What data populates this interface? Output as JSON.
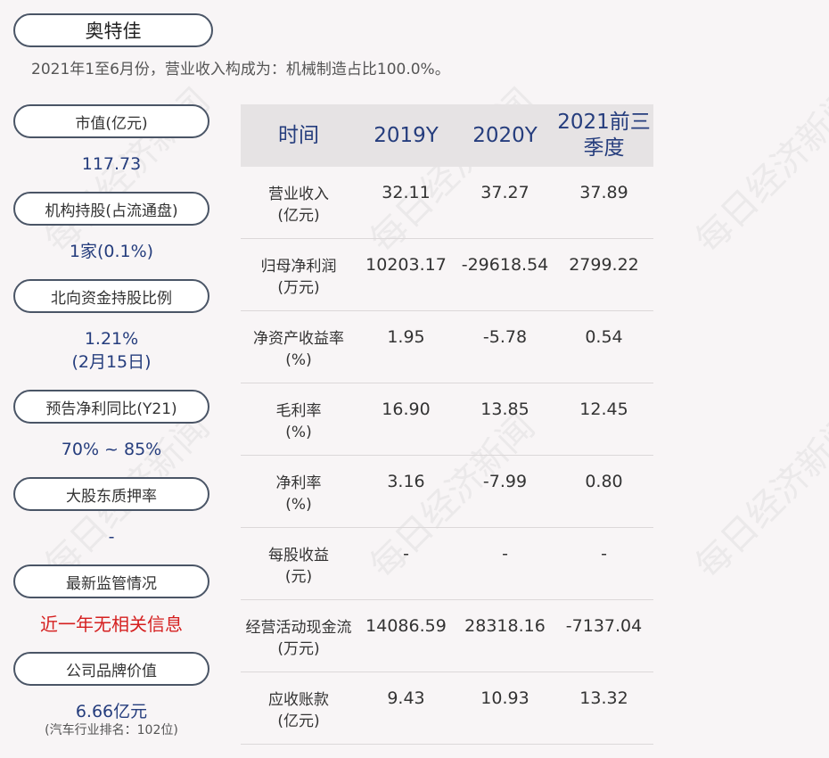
{
  "company": "奥特佳",
  "summary": "2021年1至6月份，营业收入构成为：机械制造占比100.0%。",
  "left_cards": [
    {
      "label": "市值(亿元)",
      "value": "117.73"
    },
    {
      "label": "机构持股(占流通盘)",
      "value": "1家(0.1%)"
    },
    {
      "label": "北向资金持股比例",
      "value": "1.21%",
      "value2": "(2月15日)"
    },
    {
      "label": "预告净利同比(Y21)",
      "value": "70% ~ 85%"
    },
    {
      "label": "大股东质押率",
      "value": "-"
    },
    {
      "label": "最新监管情况",
      "value": "近一年无相关信息"
    },
    {
      "label": "公司品牌价值",
      "value": "6.66亿元",
      "sub": "(汽车行业排名：102位)"
    }
  ],
  "table": {
    "headers": [
      "时间",
      "2019Y",
      "2020Y",
      "2021前三季度"
    ],
    "rows": [
      {
        "label1": "营业收入",
        "label2": "(亿元)",
        "v": [
          "32.11",
          "37.27",
          "37.89"
        ]
      },
      {
        "label1": "归母净利润",
        "label2": "(万元)",
        "v": [
          "10203.17",
          "-29618.54",
          "2799.22"
        ]
      },
      {
        "label1": "净资产收益率",
        "label2": "(%)",
        "v": [
          "1.95",
          "-5.78",
          "0.54"
        ]
      },
      {
        "label1": "毛利率",
        "label2": "(%)",
        "v": [
          "16.90",
          "13.85",
          "12.45"
        ]
      },
      {
        "label1": "净利率",
        "label2": "(%)",
        "v": [
          "3.16",
          "-7.99",
          "0.80"
        ]
      },
      {
        "label1": "每股收益",
        "label2": "(元)",
        "v": [
          "-",
          "-",
          "-"
        ]
      },
      {
        "label1": "经营活动现金流",
        "label2": "(万元)",
        "v": [
          "14086.59",
          "28318.16",
          "-7137.04"
        ]
      },
      {
        "label1": "应收账款",
        "label2": "(亿元)",
        "v": [
          "9.43",
          "10.93",
          "13.32"
        ]
      }
    ]
  },
  "watermark": "每日经济新闻"
}
